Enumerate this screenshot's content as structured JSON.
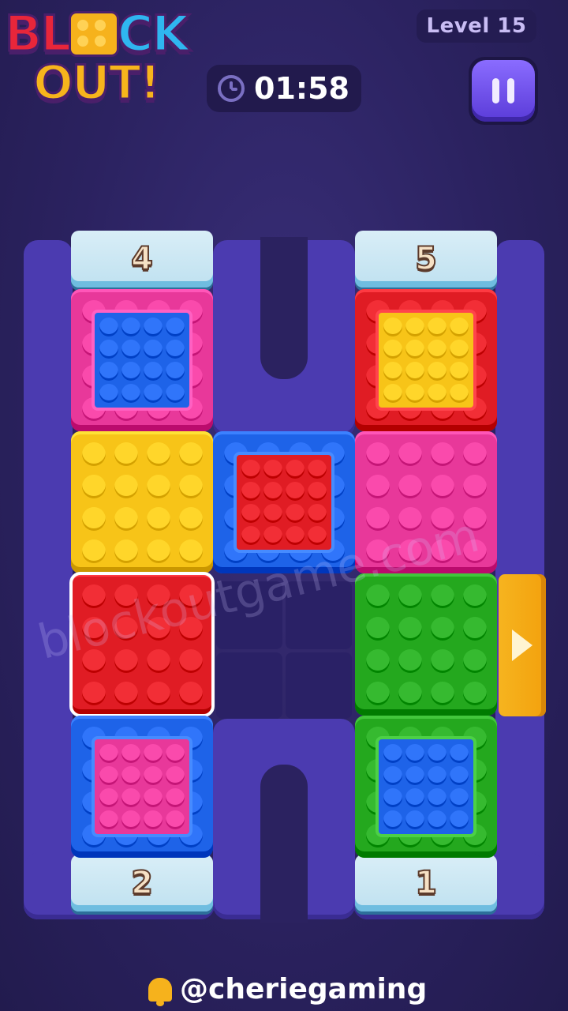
{
  "header": {
    "logo_line1": "BL",
    "logo_line1b": "CK",
    "logo_line2": "OUT!",
    "level": "Level 15",
    "timer": "01:58"
  },
  "gates": [
    {
      "id": "top-left",
      "number": "4"
    },
    {
      "id": "top-right",
      "number": "5"
    },
    {
      "id": "bottom-left",
      "number": "2"
    },
    {
      "id": "bottom-right",
      "number": "1"
    }
  ],
  "colors": {
    "red": "#e01c24",
    "pink": "#e8389a",
    "blue": "#1e63e8",
    "yellow": "#f7c418",
    "green": "#24a81e",
    "exit": "#f5ad1a"
  },
  "blocks": [
    {
      "name": "pink-blue",
      "outer": "pink",
      "inner": "blue"
    },
    {
      "name": "red-yellow",
      "outer": "red",
      "inner": "yellow"
    },
    {
      "name": "yellow",
      "outer": "yellow",
      "inner": null
    },
    {
      "name": "blue-red",
      "outer": "blue",
      "inner": "red"
    },
    {
      "name": "pink",
      "outer": "pink",
      "inner": null
    },
    {
      "name": "red-selected",
      "outer": "red",
      "inner": null
    },
    {
      "name": "green",
      "outer": "green",
      "inner": null
    },
    {
      "name": "blue-pink",
      "outer": "blue",
      "inner": "pink"
    },
    {
      "name": "green-blue",
      "outer": "green",
      "inner": "blue"
    }
  ],
  "exit_icon": "play-arrow-icon",
  "watermark": "blockoutgame.com",
  "credit": "@cheriegaming"
}
